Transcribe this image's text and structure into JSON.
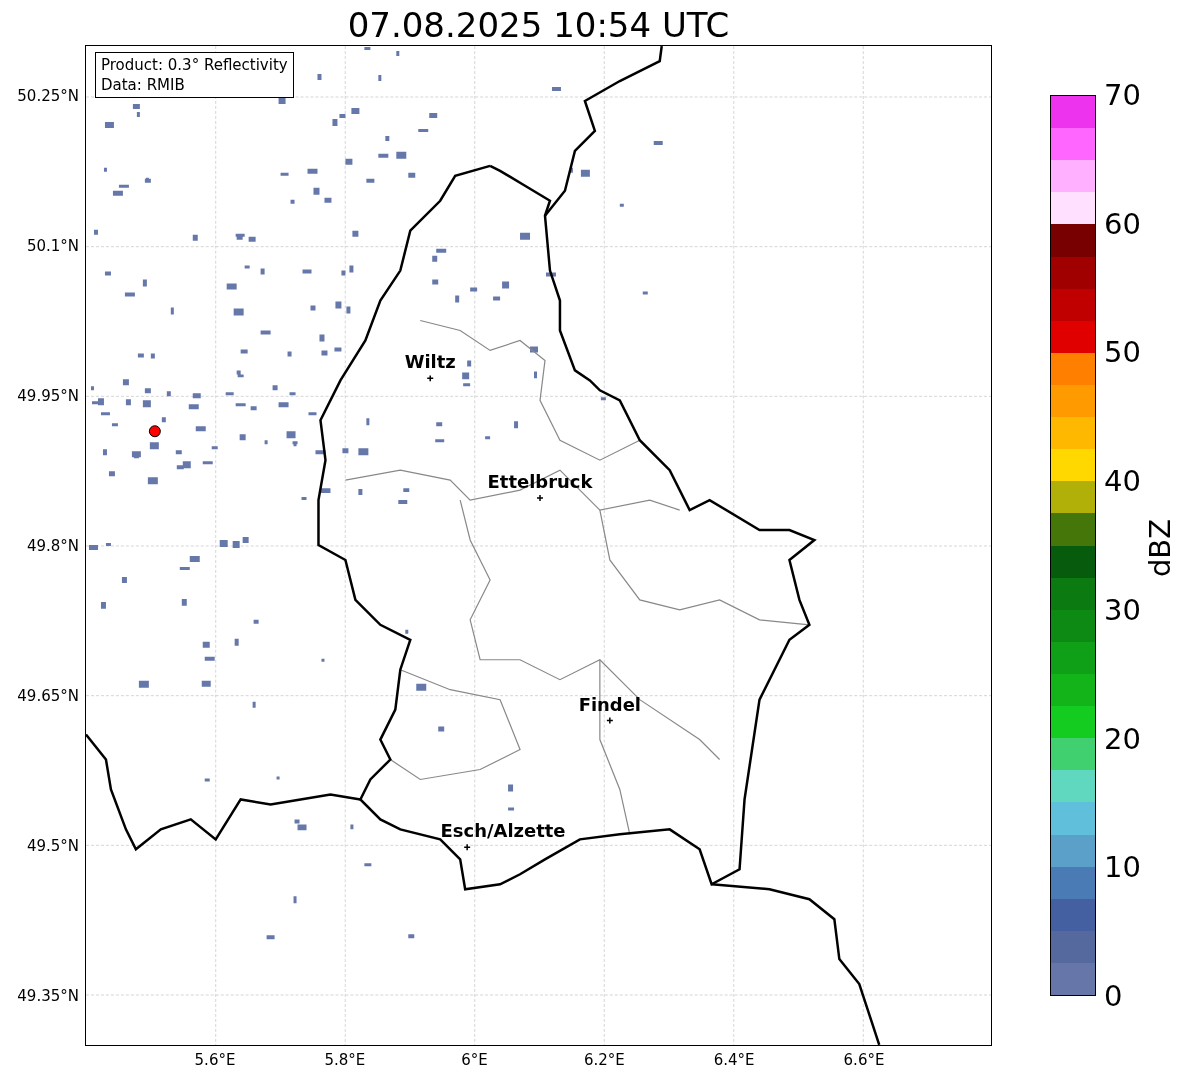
{
  "title": "07.08.2025 10:54 UTC",
  "info_box": {
    "lines": [
      "Product: 0.3° Reflectivity",
      "Data: RMIB"
    ]
  },
  "map": {
    "lat_ticks": [
      "50.25°N",
      "50.1°N",
      "49.95°N",
      "49.8°N",
      "49.65°N",
      "49.5°N",
      "49.35°N"
    ],
    "lon_ticks": [
      "5.6°E",
      "5.8°E",
      "6°E",
      "6.2°E",
      "6.4°E",
      "6.6°E"
    ],
    "cities": [
      {
        "name": "Wiltz"
      },
      {
        "name": "Ettelbruck"
      },
      {
        "name": "Findel"
      },
      {
        "name": "Esch/Alzette"
      }
    ],
    "radar_site": {
      "color": "#ff0000"
    }
  },
  "colorbar": {
    "label": "dBZ",
    "ticks": [
      "70",
      "60",
      "50",
      "40",
      "30",
      "20",
      "10",
      "0"
    ],
    "segments": [
      {
        "color": "#ee33ee"
      },
      {
        "color": "#ff66ff"
      },
      {
        "color": "#ffb0ff"
      },
      {
        "color": "#ffe0ff"
      },
      {
        "color": "#780000"
      },
      {
        "color": "#a00000"
      },
      {
        "color": "#c00000"
      },
      {
        "color": "#e00000"
      },
      {
        "color": "#ff7f00"
      },
      {
        "color": "#ff9a00"
      },
      {
        "color": "#ffb800"
      },
      {
        "color": "#ffd800"
      },
      {
        "color": "#b0b008"
      },
      {
        "color": "#44760a"
      },
      {
        "color": "#065c0c"
      },
      {
        "color": "#0b7a10"
      },
      {
        "color": "#0c8a14"
      },
      {
        "color": "#10a018"
      },
      {
        "color": "#12b41a"
      },
      {
        "color": "#14cc20"
      },
      {
        "color": "#40d070"
      },
      {
        "color": "#60d8c0"
      },
      {
        "color": "#60c0dc"
      },
      {
        "color": "#5aa0c8"
      },
      {
        "color": "#4a7bb4"
      },
      {
        "color": "#4460a0"
      },
      {
        "color": "#56699f"
      },
      {
        "color": "#6676a8"
      }
    ]
  }
}
